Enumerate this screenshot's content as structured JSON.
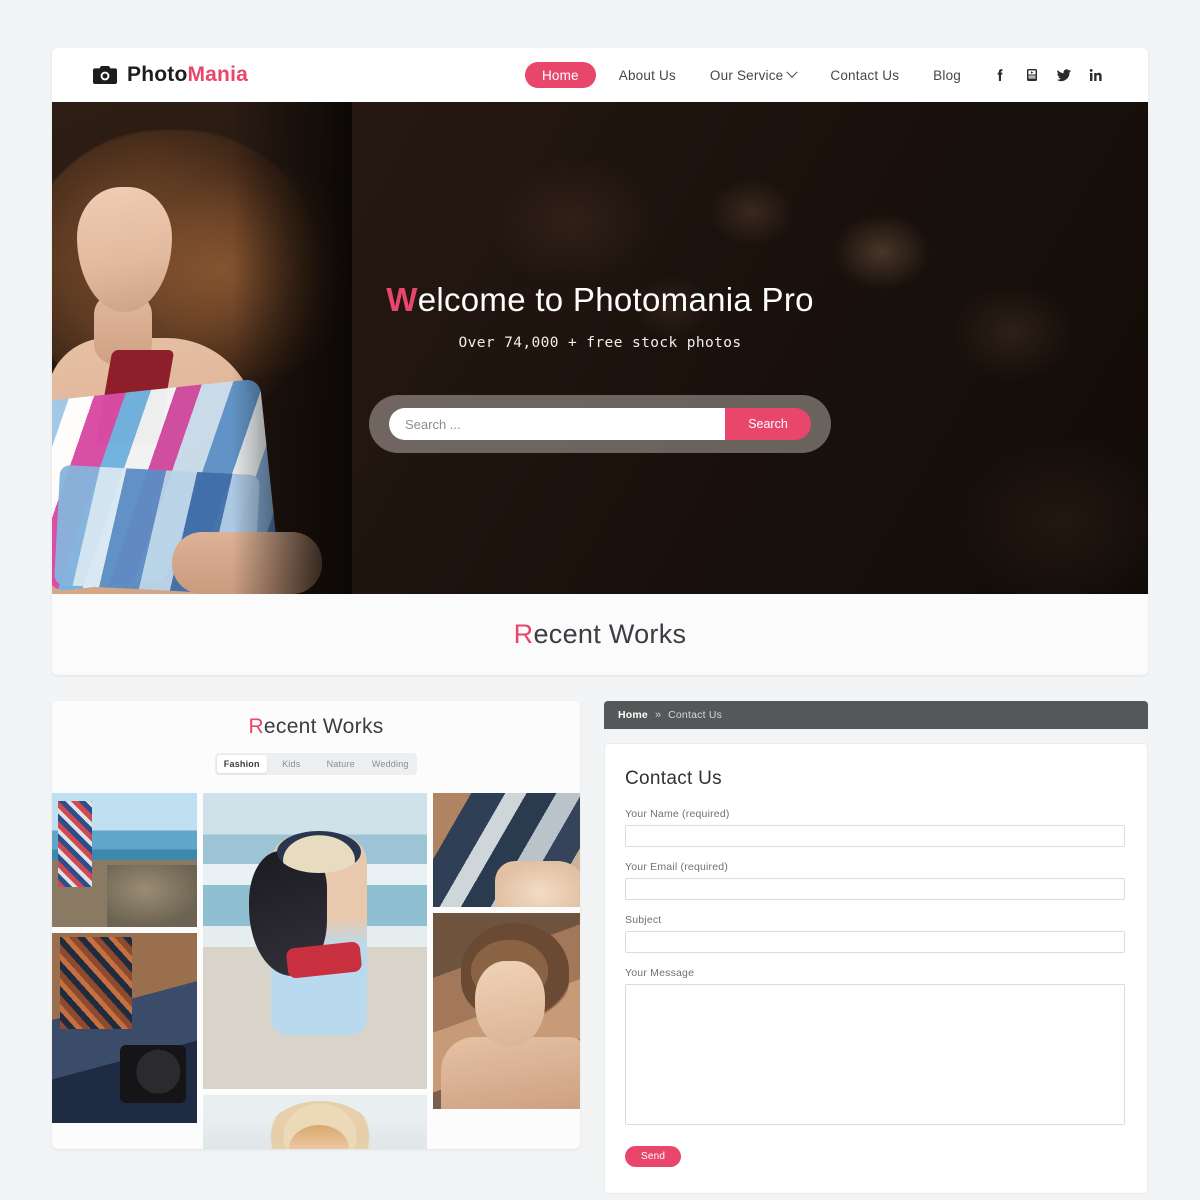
{
  "brand": {
    "part1": "Photo",
    "part2": "Mania",
    "icon": "camera-icon"
  },
  "nav": {
    "items": [
      {
        "label": "Home",
        "active": true
      },
      {
        "label": "About Us",
        "active": false
      },
      {
        "label": "Our Service",
        "active": false,
        "has_dropdown": true
      },
      {
        "label": "Contact Us",
        "active": false
      },
      {
        "label": "Blog",
        "active": false
      }
    ],
    "socials": [
      {
        "name": "facebook-icon",
        "label": "f"
      },
      {
        "name": "youtube-icon",
        "label": "YouTube"
      },
      {
        "name": "twitter-icon",
        "label": "Twitter"
      },
      {
        "name": "linkedin-icon",
        "label": "in"
      }
    ]
  },
  "hero": {
    "title_highlight": "W",
    "title_rest": "elcome to Photomania Pro",
    "subtitle": "Over 74,000 + free stock photos",
    "search": {
      "placeholder": "Search ...",
      "value": "",
      "button_label": "Search"
    }
  },
  "band": {
    "title_highlight": "R",
    "title_rest": "ecent Works"
  },
  "works": {
    "title_highlight": "R",
    "title_rest": "ecent Works",
    "filters": [
      {
        "label": "Fashion",
        "active": true
      },
      {
        "label": "Kids",
        "active": false
      },
      {
        "label": "Nature",
        "active": false
      },
      {
        "label": "Wedding",
        "active": false
      }
    ],
    "gallery": [
      {
        "name": "photo-seaside-rocks"
      },
      {
        "name": "photo-photographer-camera"
      },
      {
        "name": "photo-beach-woman-hat"
      },
      {
        "name": "photo-woman-straw-hat"
      },
      {
        "name": "photo-window-bicycle"
      },
      {
        "name": "photo-portrait-woman"
      }
    ]
  },
  "contact": {
    "breadcrumb": {
      "home": "Home",
      "separator": "»",
      "current": "Contact Us"
    },
    "title": "Contact Us",
    "fields": [
      {
        "label": "Your Name (required)",
        "value": "",
        "type": "text"
      },
      {
        "label": "Your Email (required)",
        "value": "",
        "type": "text"
      },
      {
        "label": "Subject",
        "value": "",
        "type": "text"
      },
      {
        "label": "Your Message",
        "value": "",
        "type": "textarea"
      }
    ],
    "send_label": "Send"
  },
  "colors": {
    "accent": "#e8476b",
    "page_bg": "#f3f4f6",
    "card_bg": "#ffffff",
    "breadcrumb_bg": "#555759",
    "text_dark": "#3a3d41"
  }
}
